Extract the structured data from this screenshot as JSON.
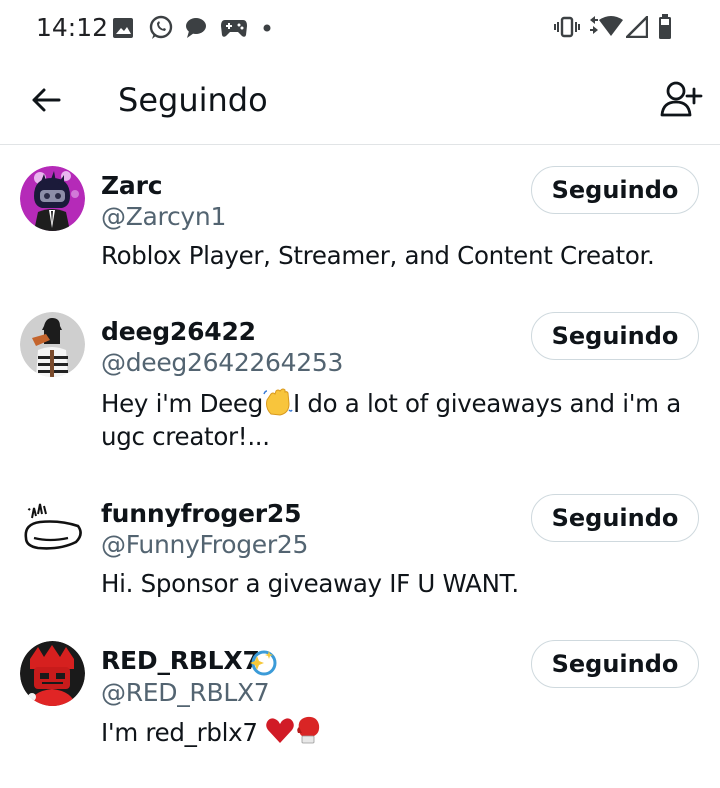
{
  "status_bar": {
    "time": "14:12",
    "left_icons": [
      "image-icon",
      "whatsapp-icon",
      "chat-bubble-icon",
      "game-controller-icon",
      "dot-icon"
    ],
    "right_icons": [
      "vibrate-icon",
      "wifi-icon",
      "signal-icon",
      "battery-icon"
    ]
  },
  "header": {
    "title": "Seguindo",
    "back_icon": "arrow-left-icon",
    "add_user_icon": "add-user-icon"
  },
  "users": [
    {
      "display_name": "Zarc",
      "handle": "@Zarcyn1",
      "bio": "Roblox Player, Streamer, and Content Creator.",
      "button_label": "Seguindo",
      "avatar_bg": "#b52ab8"
    },
    {
      "display_name": "deeg26422",
      "handle": "@deeg2642264253",
      "bio_part1": "Hey i'm Deeg",
      "bio_emoji": "waving-hand-emoji",
      "bio_part2": "I do a lot of giveaways and i'm a ugc creator!...",
      "button_label": "Seguindo",
      "avatar_bg": "#cfcfcf"
    },
    {
      "display_name": "funnyfroger25",
      "handle": "@FunnyFroger25",
      "bio": "Hi. Sponsor a giveaway IF U WANT.",
      "button_label": "Seguindo",
      "avatar_bg": "#ffffff"
    },
    {
      "display_name": "RED_RBLX7",
      "handle": "@RED_RBLX7",
      "bio": "I'm red_rblx7",
      "badge_icon": "sparkle-badge-icon",
      "bio_emojis": [
        "red-heart-emoji",
        "boxing-glove-emoji"
      ],
      "button_label": "Seguindo",
      "avatar_bg": "#1a1a1a"
    }
  ],
  "colors": {
    "text_primary": "#0f1419",
    "text_secondary": "#536471",
    "divider": "#e1e4e6",
    "button_border": "#cfd9de"
  }
}
